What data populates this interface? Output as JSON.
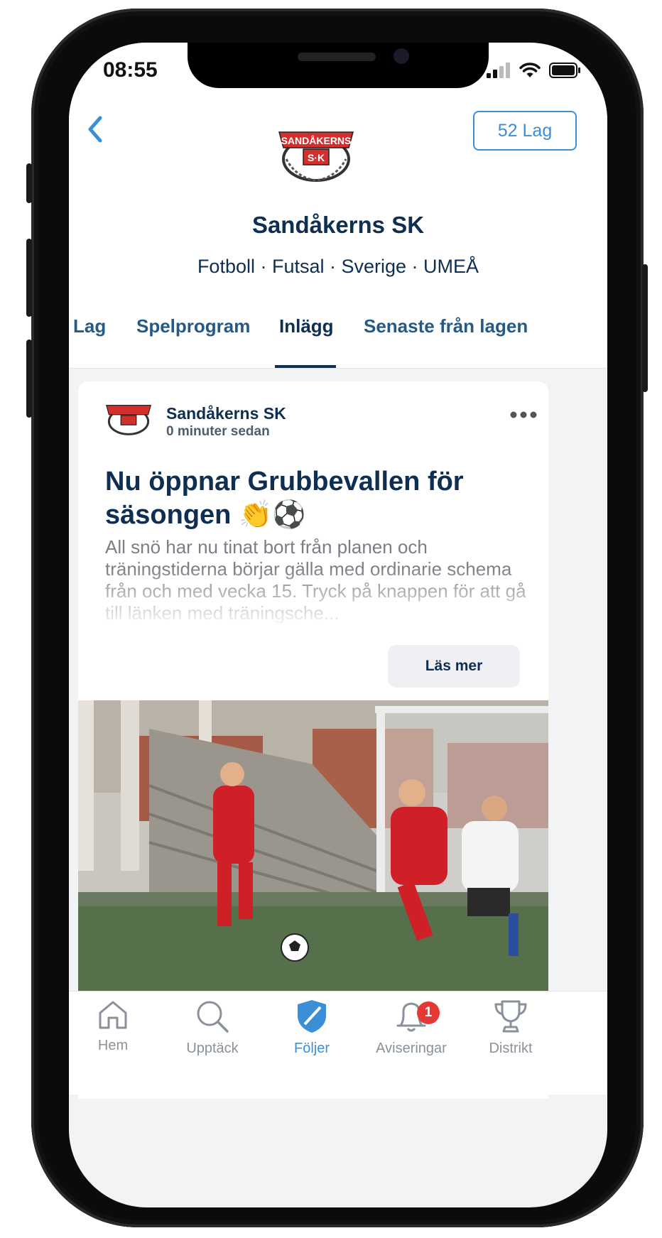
{
  "status_bar": {
    "time": "08:55"
  },
  "header": {
    "teams_button": "52 Lag",
    "club_name": "Sandåkerns SK",
    "club_meta": "Fotboll · Futsal · Sverige · UMEÅ",
    "logo_text": "SANDÅKERNS",
    "logo_initials": "S·K"
  },
  "tabs": [
    {
      "label": "Lag"
    },
    {
      "label": "Spelprogram"
    },
    {
      "label": "Inlägg"
    },
    {
      "label": "Senaste från lagen"
    }
  ],
  "post": {
    "author": "Sandåkerns SK",
    "time": "0 minuter sedan",
    "title": "Nu öppnar Grubbevallen för säsongen 👏⚽",
    "body": "All snö har nu tinat bort från planen och träningstiderna börjar gälla med ordinarie schema från och med vecka 15. Tryck på knappen för att gå till länken med träningsche...",
    "read_more": "Läs mer"
  },
  "tabbar": [
    {
      "label": "Hem",
      "icon": "home-icon"
    },
    {
      "label": "Upptäck",
      "icon": "search-icon"
    },
    {
      "label": "Följer",
      "icon": "shield-icon"
    },
    {
      "label": "Aviseringar",
      "icon": "bell-icon",
      "badge": "1"
    },
    {
      "label": "Distrikt",
      "icon": "trophy-icon"
    }
  ],
  "colors": {
    "accent": "#3a8fd6",
    "navy": "#0e2e52",
    "badge": "#e53935"
  }
}
